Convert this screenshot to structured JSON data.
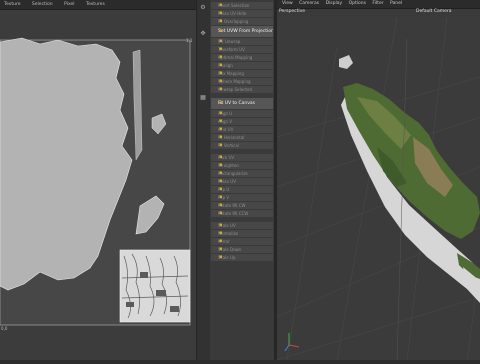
{
  "uv_editor": {
    "menu": [
      "Texture",
      "Selection",
      "Pixel",
      "Textures"
    ],
    "corner_top_right": "1,1",
    "corner_bottom_left": "0,0"
  },
  "commands": {
    "items": [
      {
        "label": "Invert Selection",
        "highlight": false
      },
      {
        "label": "Relax UV Hide",
        "highlight": false
      },
      {
        "label": "Fit Overlapping",
        "highlight": false
      },
      {
        "label": "Set UVW From Projection",
        "highlight": true
      },
      {
        "label": "UV Unwrap",
        "highlight": false
      },
      {
        "label": "Transform UV",
        "highlight": false
      },
      {
        "label": "Optimal Mapping",
        "highlight": false
      },
      {
        "label": "Realign",
        "highlight": false
      },
      {
        "label": "Box Mapping",
        "highlight": false
      },
      {
        "label": "Sphere Mapping",
        "highlight": false
      },
      {
        "label": "Unwrap Selected",
        "highlight": false
      },
      {
        "label": "Fit UV to Canvas",
        "highlight": true
      },
      {
        "label": "Align U",
        "highlight": false
      },
      {
        "label": "Align V",
        "highlight": false
      },
      {
        "label": "Grid UV",
        "highlight": false
      },
      {
        "label": "Fit Horizontal",
        "highlight": false
      },
      {
        "label": "Fit Vertical",
        "highlight": false
      },
      {
        "label": "Pack UV",
        "highlight": false
      },
      {
        "label": "Straighten",
        "highlight": false
      },
      {
        "label": "Rectangularize",
        "highlight": false
      },
      {
        "label": "Relax UV",
        "highlight": false
      },
      {
        "label": "Flip U",
        "highlight": false
      },
      {
        "label": "Flip V",
        "highlight": false
      },
      {
        "label": "Rotate 90 CW",
        "highlight": false
      },
      {
        "label": "Rotate 90 CCW",
        "highlight": false
      },
      {
        "label": "Scale UV",
        "highlight": false
      },
      {
        "label": "Normalize",
        "highlight": false
      },
      {
        "label": "Mirror",
        "highlight": false
      },
      {
        "label": "Scale Down",
        "highlight": false
      },
      {
        "label": "Scale Up",
        "highlight": false
      }
    ]
  },
  "viewport": {
    "menu": [
      "View",
      "Cameras",
      "Display",
      "Options",
      "Filter",
      "Panel"
    ],
    "label": "Perspective",
    "camera": "Default Camera"
  }
}
